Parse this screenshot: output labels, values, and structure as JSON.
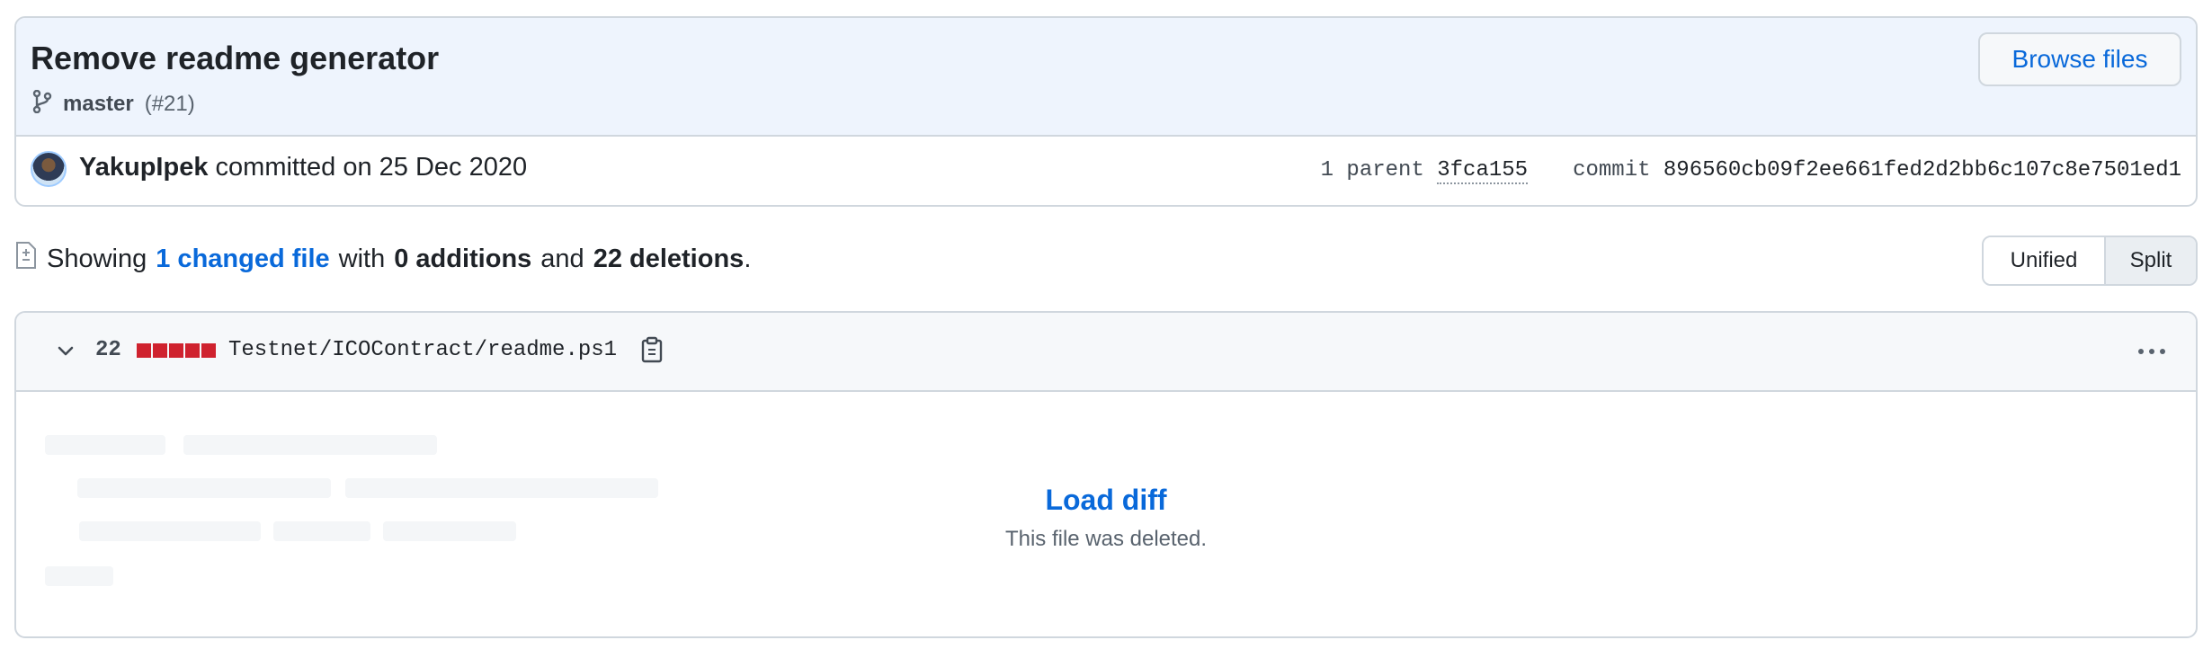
{
  "commit": {
    "title": "Remove readme generator",
    "branch": "master",
    "pr_ref": "(#21)",
    "browse_files_label": "Browse files",
    "author": "YakupIpek",
    "committed_text": "committed on 25 Dec 2020",
    "parent_label": "1 parent",
    "parent_sha": "3fca155",
    "commit_label": "commit",
    "commit_sha": "896560cb09f2ee661fed2d2bb6c107c8e7501ed1"
  },
  "summary": {
    "prefix": "Showing",
    "changed_files": "1 changed file",
    "with": "with",
    "additions": "0 additions",
    "and": "and",
    "deletions": "22 deletions",
    "suffix": "."
  },
  "view_toggle": {
    "unified_label": "Unified",
    "split_label": "Split",
    "selected": "Split"
  },
  "file": {
    "deletion_count": "22",
    "path": "Testnet/ICOContract/readme.ps1",
    "load_diff_label": "Load diff",
    "note": "This file was deleted."
  },
  "colors": {
    "link": "#0969da",
    "deletion": "#cf222e",
    "header_bg": "#eef4fd"
  },
  "icons": [
    "git-branch-icon",
    "avatar",
    "file-diff-icon",
    "chevron-down-icon",
    "copy-icon",
    "kebab-horizontal-icon"
  ]
}
